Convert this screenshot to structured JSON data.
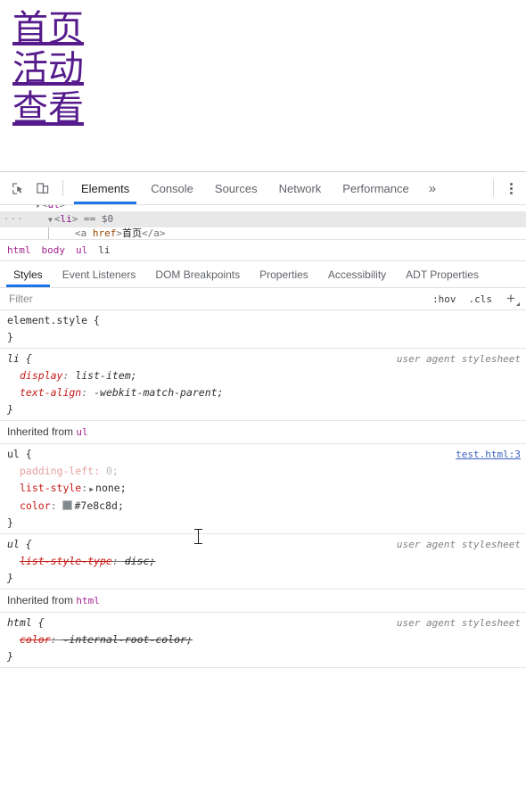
{
  "page": {
    "links": [
      {
        "label": "首页",
        "href": ""
      },
      {
        "label": "活动",
        "href": ""
      },
      {
        "label": "查看",
        "href": ""
      }
    ],
    "link_color": "#551a8b"
  },
  "devtools": {
    "toolbar": {
      "inspect_icon": "inspect-element-icon",
      "device_icon": "device-toolbar-icon",
      "tabs": [
        {
          "label": "Elements",
          "active": true
        },
        {
          "label": "Console",
          "active": false
        },
        {
          "label": "Sources",
          "active": false
        },
        {
          "label": "Network",
          "active": false
        },
        {
          "label": "Performance",
          "active": false
        }
      ],
      "more_tabs_label": "»",
      "menu_icon": "kebab-menu-icon"
    },
    "dom_tree": {
      "rows": [
        {
          "indent": 40,
          "triangle": "▼",
          "text": "<ul>",
          "selected": false,
          "dots": false
        },
        {
          "indent": 54,
          "triangle": "▼",
          "text": "<li>",
          "suffix": "== $0",
          "selected": true,
          "dots": true
        },
        {
          "indent": 84,
          "triangle": "",
          "text": "<a href>首页</a>",
          "selected": false,
          "dots": false
        }
      ],
      "row1_tag": "ul",
      "row2_tag": "li",
      "row2_marker": "== $0",
      "row3_open": "<a",
      "row3_attr": "href",
      "row3_text": "首页",
      "row3_close": "</a>"
    },
    "breadcrumbs": [
      "html",
      "body",
      "ul",
      "li"
    ],
    "styles_tabs": [
      {
        "label": "Styles",
        "active": true
      },
      {
        "label": "Event Listeners",
        "active": false
      },
      {
        "label": "DOM Breakpoints",
        "active": false
      },
      {
        "label": "Properties",
        "active": false
      },
      {
        "label": "Accessibility",
        "active": false
      },
      {
        "label": "ADT Properties",
        "active": false
      }
    ],
    "filter_bar": {
      "placeholder": "Filter",
      "value": "",
      "hov_label": ":hov",
      "cls_label": ".cls",
      "new_rule_label": "+"
    },
    "rules": {
      "element_style": {
        "selector": "element.style {",
        "close": "}"
      },
      "li_rule": {
        "selector": "li {",
        "origin": "user agent stylesheet",
        "decls": [
          {
            "prop": "display",
            "value": "list-item;"
          },
          {
            "prop": "text-align",
            "value": "-webkit-match-parent;"
          }
        ],
        "close": "}"
      },
      "inherited_ul_label": "Inherited from",
      "inherited_ul_tag": "ul",
      "ul_author_rule": {
        "selector": "ul {",
        "origin": "test.html:3",
        "decls": [
          {
            "prop": "padding-left",
            "value": "0;",
            "inactive": true
          },
          {
            "prop": "list-style",
            "value": "none;",
            "expander": "▶"
          },
          {
            "prop": "color",
            "value": "#7e8c8d;",
            "swatch": "#7e8c8d"
          }
        ],
        "close": "}"
      },
      "ul_ua_rule": {
        "selector": "ul {",
        "origin": "user agent stylesheet",
        "decls": [
          {
            "prop": "list-style-type",
            "value": "disc;",
            "disabled": true
          }
        ],
        "close": "}"
      },
      "inherited_html_label": "Inherited from",
      "inherited_html_tag": "html",
      "html_ua_rule": {
        "selector": "html {",
        "origin": "user agent stylesheet",
        "decls": [
          {
            "prop": "color",
            "value": "-internal-root-color;",
            "disabled": true
          }
        ],
        "close": "}"
      }
    }
  }
}
